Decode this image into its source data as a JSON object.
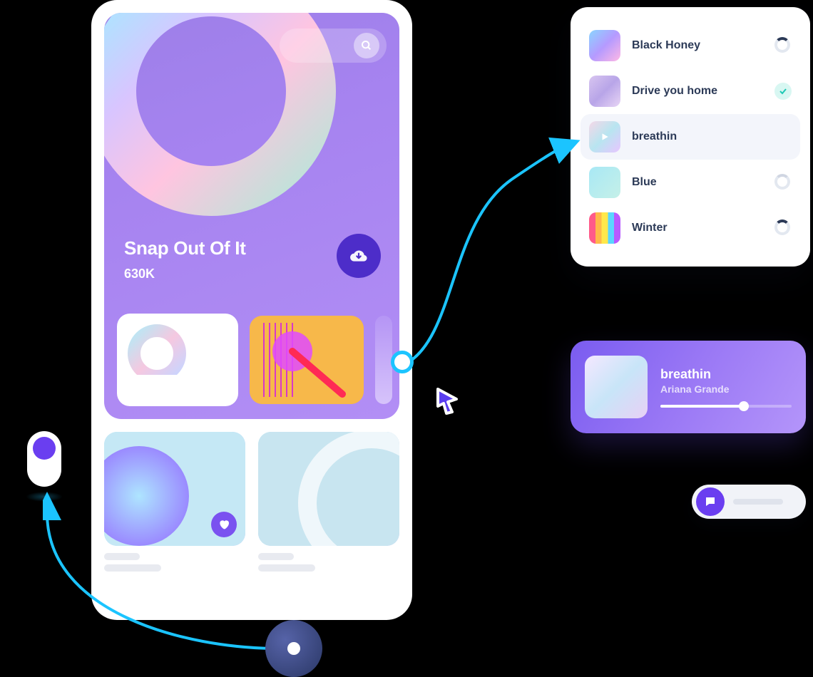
{
  "hero": {
    "title": "Snap Out Of It",
    "count": "630K"
  },
  "playlist": {
    "tracks": [
      {
        "name": "Black Honey",
        "status": "loading"
      },
      {
        "name": "Drive you home",
        "status": "done"
      },
      {
        "name": "breathin",
        "status": "playing"
      },
      {
        "name": "Blue",
        "status": "loading"
      },
      {
        "name": "Winter",
        "status": "loading"
      }
    ],
    "selectedIndex": 2
  },
  "nowplaying": {
    "title": "breathin",
    "artist": "Ariana Grande",
    "progress": 62
  },
  "colors": {
    "accent": "#6a3ef0",
    "connector": "#1bc4ff"
  }
}
